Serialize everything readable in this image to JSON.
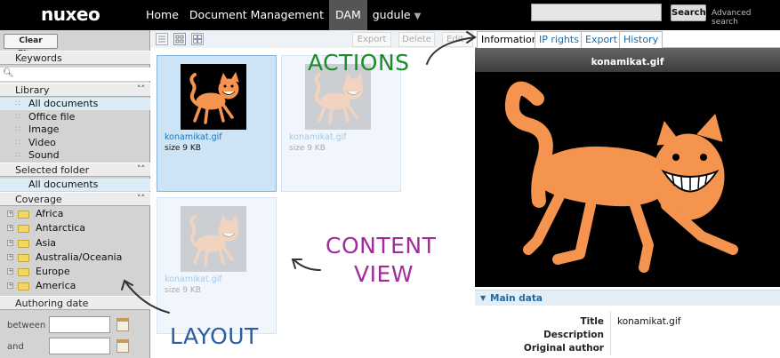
{
  "header": {
    "logo": "nuxeo",
    "nav": [
      {
        "label": "Home"
      },
      {
        "label": "Document Management"
      },
      {
        "label": "DAM"
      },
      {
        "label": "gudule"
      }
    ],
    "search_button": "Search",
    "advanced_search": "Advanced search"
  },
  "sidebar": {
    "clear_filters": "Clear filters",
    "keywords_label": "Keywords",
    "library_label": "Library",
    "library_items": [
      "All documents",
      "Office file",
      "Image",
      "Video",
      "Sound"
    ],
    "selected_folder_label": "Selected folder",
    "selected_folder_item": "All documents",
    "coverage_label": "Coverage",
    "coverage_items": [
      "Africa",
      "Antarctica",
      "Asia",
      "Australia/Oceania",
      "Europe",
      "America"
    ],
    "authoring_date_label": "Authoring date",
    "between_label": "between",
    "and_label": "and"
  },
  "toolbar": {
    "export": "Export",
    "delete": "Delete",
    "edit": "Edit"
  },
  "content": {
    "items": [
      {
        "title": "konamikat.gif",
        "size": "size 9 KB"
      },
      {
        "title": "konamikat.gif",
        "size": "size 9 KB"
      },
      {
        "title": "konamikat.gif",
        "size": "size 9 KB"
      }
    ]
  },
  "panel": {
    "tabs": [
      "Information",
      "IP rights",
      "Export",
      "History"
    ],
    "preview_title": "konamikat.gif",
    "main_data_label": "Main data",
    "fields": [
      {
        "label": "Title",
        "value": "konamikat.gif"
      },
      {
        "label": "Description",
        "value": ""
      },
      {
        "label": "Original author",
        "value": ""
      }
    ]
  },
  "annotations": {
    "actions": "ACTIONS",
    "content_line1": "CONTENT",
    "content_line2": "VIEW",
    "layout": "LAYOUT"
  },
  "colors": {
    "accent_blue": "#1b6ba8",
    "cat_orange": "#f5944f",
    "annot_green": "#1e8a2a",
    "annot_purple": "#a32a9c",
    "annot_blue": "#2a5da3"
  }
}
